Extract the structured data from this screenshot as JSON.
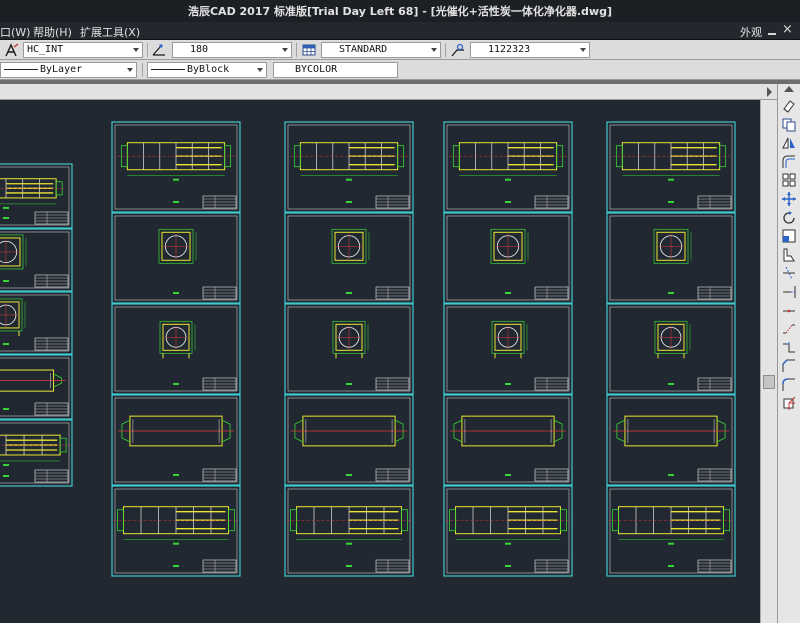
{
  "window": {
    "title": "浩辰CAD 2017 标准版[Trial Day Left 68] - [光催化+活性炭一体化净化器.dwg]",
    "close_glyph": "×"
  },
  "menu": {
    "window_partial": "口(W)",
    "help": "帮助(H)",
    "extensions": "扩展工具(X)",
    "view_partial": "外观"
  },
  "toolbar_text": {
    "text_style": "HC_INT",
    "text_height": "180",
    "dim_style": "STANDARD",
    "dim_value": "1122323"
  },
  "properties": {
    "linetype": "ByLayer",
    "lineweight": "ByBlock",
    "color": "BYCOLOR"
  },
  "colors": {
    "frame": "#3fc9cc",
    "yellow": "#e8e632",
    "green": "#36d636",
    "red": "#e33b3b",
    "white": "#e6e6e6",
    "canvas_bg": "#222831"
  },
  "icons": [
    "text-style-icon",
    "dim-icon",
    "table-icon",
    "leader-icon",
    "erase-icon",
    "copy-icon",
    "mirror-icon",
    "offset-icon",
    "array-icon",
    "move-icon",
    "rotate-icon",
    "scale-icon",
    "stretch-icon",
    "trim-icon",
    "extend-icon",
    "break-point-icon",
    "break-icon",
    "join-icon",
    "chamfer-icon",
    "fillet-icon",
    "explode-icon"
  ]
}
